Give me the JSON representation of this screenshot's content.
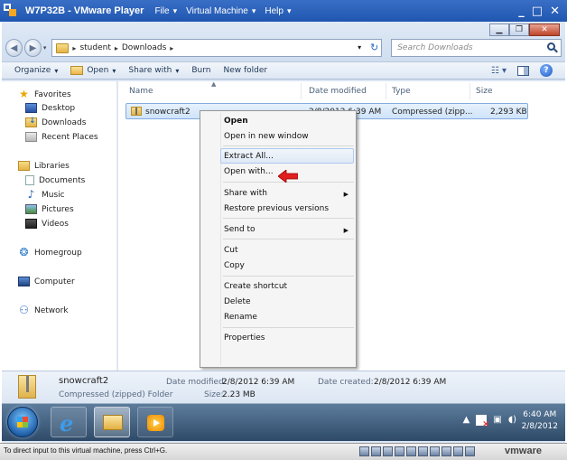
{
  "vmware": {
    "title": "W7P32B - VMware Player",
    "menu": [
      "File",
      "Virtual Machine",
      "Help"
    ],
    "status_message": "To direct input to this virtual machine, press Ctrl+G.",
    "brand": "vmware"
  },
  "window_buttons": {
    "minimize": "▁",
    "restore": "❐",
    "close": "✕"
  },
  "address": {
    "crumbs": [
      "student",
      "Downloads"
    ],
    "search_placeholder": "Search Downloads"
  },
  "toolbar": {
    "organize": "Organize",
    "open": "Open",
    "share_with": "Share with",
    "burn": "Burn",
    "new_folder": "New folder"
  },
  "nav": {
    "favorites": "Favorites",
    "desktop": "Desktop",
    "downloads": "Downloads",
    "recent": "Recent Places",
    "libraries": "Libraries",
    "documents": "Documents",
    "music": "Music",
    "pictures": "Pictures",
    "videos": "Videos",
    "homegroup": "Homegroup",
    "computer": "Computer",
    "network": "Network"
  },
  "columns": {
    "name": "Name",
    "date": "Date modified",
    "type": "Type",
    "size": "Size"
  },
  "file": {
    "name": "snowcraft2",
    "date": "2/8/2012 6:39 AM",
    "type": "Compressed (zipp...",
    "size": "2,293 KB"
  },
  "context_menu": {
    "open": "Open",
    "open_new_window": "Open in new window",
    "extract_all": "Extract All...",
    "open_with": "Open with...",
    "share_with": "Share with",
    "restore_previous": "Restore previous versions",
    "send_to": "Send to",
    "cut": "Cut",
    "copy": "Copy",
    "create_shortcut": "Create shortcut",
    "delete": "Delete",
    "rename": "Rename",
    "properties": "Properties"
  },
  "details": {
    "name": "snowcraft2",
    "type": "Compressed (zipped) Folder",
    "date_modified_label": "Date modified:",
    "date_modified": "2/8/2012 6:39 AM",
    "date_created_label": "Date created:",
    "date_created": "2/8/2012 6:39 AM",
    "size_label": "Size:",
    "size": "2.23 MB"
  },
  "taskbar": {
    "time": "6:40 AM",
    "date": "2/8/2012"
  },
  "colors": {
    "highlight_arrow": "#e02020",
    "selection": "#cfe3f9",
    "accent": "#1f56b0"
  }
}
